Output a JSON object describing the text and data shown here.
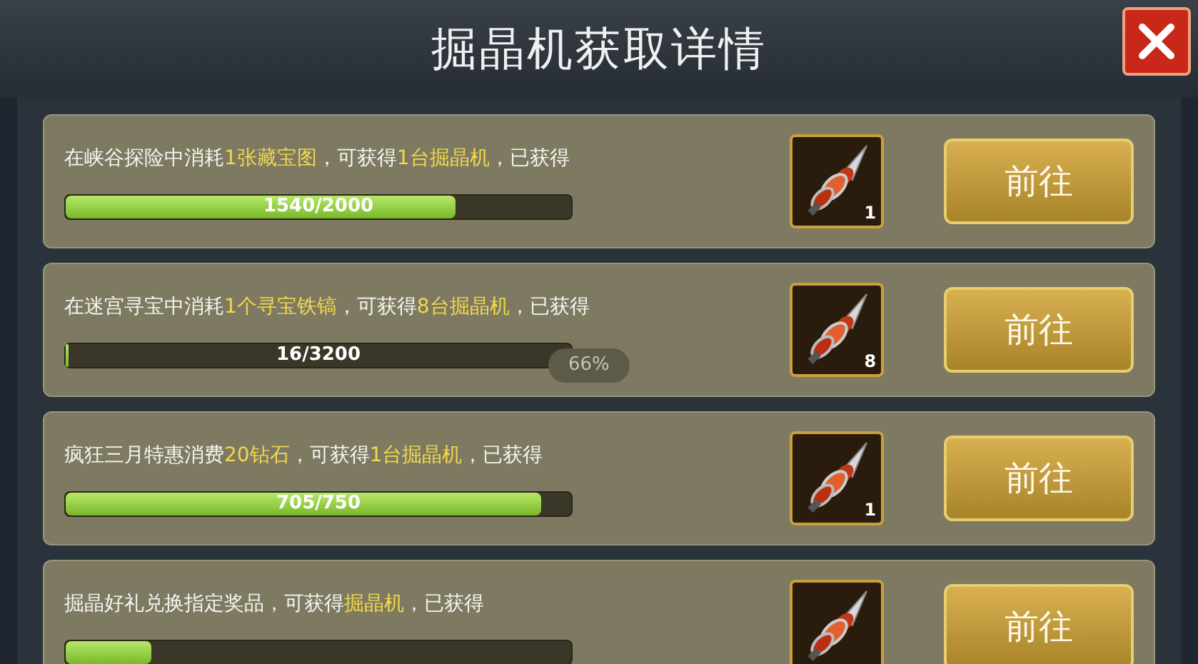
{
  "window": {
    "title": "掘晶机获取详情"
  },
  "overlay_badge": "66%",
  "tasks": [
    {
      "description": "在峡谷探险中消耗**1张藏宝图**，可获得**1台掘晶机**，已获得",
      "level": 0.77,
      "progress": "1540/2000",
      "reward_count": "1",
      "button": "前往"
    },
    {
      "description": "在迷宫寻宝中消耗**1个寻宝铁镐**，可获得**8台掘晶机**，已获得",
      "level": 0.005,
      "progress": "16/3200",
      "reward_count": "8",
      "button": "前往"
    },
    {
      "description": "疯狂三月特惠消费**20钻石**，可获得**1台掘晶机**，已获得",
      "level": 0.94,
      "progress": "705/750",
      "reward_count": "1",
      "button": "前往"
    },
    {
      "description": "掘晶好礼兑换指定奖品，可获得**掘晶机**，已获得",
      "level": 0.17,
      "button": "前往"
    }
  ]
}
